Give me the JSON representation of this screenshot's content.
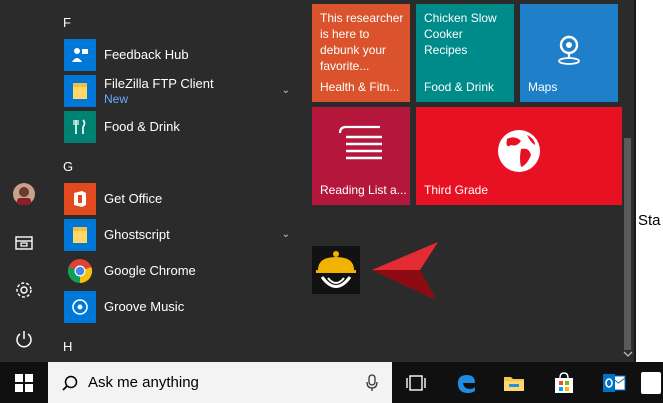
{
  "start_menu": {
    "sections": [
      {
        "letter": "F",
        "apps": [
          {
            "name": "Feedback Hub",
            "icon": "feedback-hub-icon",
            "color": "#0078d7"
          },
          {
            "name": "FileZilla FTP Client",
            "sub": "New",
            "icon": "folder-icon",
            "color": "#0078d7",
            "expandable": true
          },
          {
            "name": "Food & Drink",
            "icon": "food-drink-icon",
            "color": "#008272"
          }
        ]
      },
      {
        "letter": "G",
        "apps": [
          {
            "name": "Get Office",
            "icon": "office-icon",
            "color": "#e2491e"
          },
          {
            "name": "Ghostscript",
            "icon": "folder-icon",
            "color": "#0078d7",
            "expandable": true
          },
          {
            "name": "Google Chrome",
            "icon": "chrome-icon",
            "color": "#2b2b2b"
          },
          {
            "name": "Groove Music",
            "icon": "groove-music-icon",
            "color": "#0078d7"
          }
        ]
      },
      {
        "letter": "H",
        "apps": []
      }
    ],
    "rail": [
      "user-avatar",
      "file-explorer-icon",
      "settings-icon",
      "power-icon"
    ]
  },
  "tiles": [
    {
      "text": "This researcher is here to debunk your favorite...",
      "label": "Health & Fitn...",
      "color": "#da532c"
    },
    {
      "text": "Chicken Slow Cooker Recipes",
      "label": "Food & Drink",
      "color": "#008b8b"
    },
    {
      "text": "",
      "label": "Maps",
      "color": "#1f7fc8"
    },
    {
      "text": "",
      "label": "Reading List a...",
      "color": "#b4173b"
    },
    {
      "text": "",
      "label": "Third Grade",
      "color": "#e81123"
    }
  ],
  "background_window": {
    "stub_text": "Sta"
  },
  "taskbar": {
    "search_placeholder": "Ask me anything",
    "icons": [
      "task-view-icon",
      "edge-icon",
      "file-explorer-icon",
      "store-icon",
      "outlook-icon"
    ]
  },
  "colors": {
    "accent": "#0078d7",
    "arrow": "#c8141e"
  }
}
